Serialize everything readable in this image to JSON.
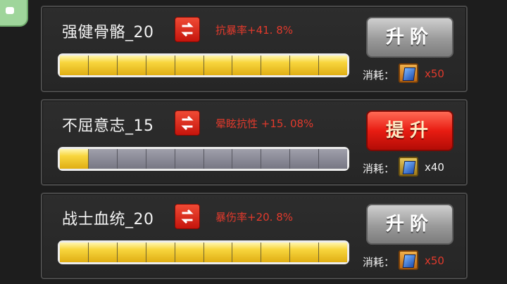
{
  "skills": [
    {
      "name": "强健骨骼_20",
      "effect": "抗暴率+41. 8%",
      "progress_segments_filled": 10,
      "progress_segments_total": 10,
      "button_label": "升阶",
      "button_style": "gray",
      "cost_label": "消耗：",
      "cost_icon": "orange-book-icon",
      "cost_qty": "x50",
      "cost_qty_color": "red"
    },
    {
      "name": "不屈意志_15",
      "effect": "晕眩抗性  +15. 08%",
      "progress_segments_filled": 1,
      "progress_segments_total": 10,
      "button_label": "提升",
      "button_style": "red",
      "cost_label": "消耗：",
      "cost_icon": "blue-book-icon",
      "cost_qty": "x40",
      "cost_qty_color": "white"
    },
    {
      "name": "战士血统_20",
      "effect": "暴伤率+20. 8%",
      "progress_segments_filled": 10,
      "progress_segments_total": 10,
      "button_label": "升阶",
      "button_style": "gray",
      "cost_label": "消耗：",
      "cost_icon": "orange-book-icon",
      "cost_qty": "x50",
      "cost_qty_color": "red"
    }
  ],
  "colors": {
    "effect_text": "#e23a2c",
    "bar_fill": "#f8d63e",
    "bar_empty": "#8c8c98",
    "upgrade_button": "#e81c12",
    "advance_button": "#9a9a9a"
  },
  "icons": {
    "swap": "swap-arrows-icon",
    "corner": "chat-app-icon"
  }
}
